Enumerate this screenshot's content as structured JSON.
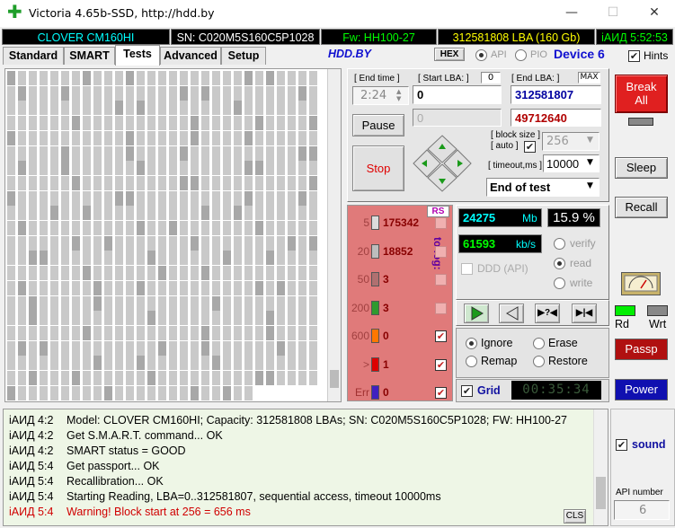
{
  "window": {
    "title": "Victoria 4.65b-SSD, http://hdd.by",
    "minimize": "—",
    "maximize": "☐",
    "close": "✕"
  },
  "infobar": {
    "model": "CLOVER CM160HI",
    "serial": "SN: C020M5S160C5P1028",
    "firmware": "Fw: HH100-27",
    "lba": "312581808 LBA (160 Gb)",
    "time": "iАИД 5:52:53"
  },
  "tabs": [
    "Standard",
    "SMART",
    "Tests",
    "Advanced",
    "Setup"
  ],
  "tab_active": "Tests",
  "toolbar": {
    "site": "HDD.BY",
    "hex": "HEX",
    "api": "API",
    "pio": "PIO",
    "device": "Device 6",
    "hints": "Hints",
    "hints_checked": true
  },
  "test": {
    "end_time_label": "[ End time ]",
    "end_time_value": "2:24",
    "start_lba_label": "[ Start LBA: ]",
    "start_lba_small": "0",
    "start_lba_value": "0",
    "start_lba_current": "0",
    "end_lba_label": "[ End LBA: ]",
    "end_lba_max": "MAX",
    "end_lba_value": "312581807",
    "end_lba_current": "49712640",
    "pause": "Pause",
    "stop": "Stop",
    "block_size_label": "[ block size ]",
    "block_auto_label": "[ auto ]",
    "block_size_value": "256",
    "timeout_label": "[ timeout,ms ]",
    "timeout_value": "10000",
    "end_action": "End of test"
  },
  "histogram": {
    "rs": "RS",
    "to_log": "to log:",
    "rows": [
      {
        "label": "5",
        "value": "175342",
        "color": "#dcdcdc",
        "log": false
      },
      {
        "label": "20",
        "value": "18852",
        "color": "#bdbdbd",
        "log": false
      },
      {
        "label": "50",
        "value": "3",
        "color": "#b07070",
        "log": false
      },
      {
        "label": "200",
        "value": "3",
        "color": "#2f9a2f",
        "log": false
      },
      {
        "label": "600",
        "value": "0",
        "color": "#ff7700",
        "log": true
      },
      {
        "label": ">",
        "value": "1",
        "color": "#dd0000",
        "log": true
      },
      {
        "label": "Err",
        "value": "0",
        "color": "#4020c0",
        "log": true
      }
    ]
  },
  "stats": {
    "mb": "24275",
    "mb_unit": "Mb",
    "percent": "15.9 %",
    "speed": "61593",
    "speed_unit": "kb/s",
    "ddd": "DDD (API)",
    "verify": "verify",
    "read": "read",
    "write": "write"
  },
  "actions": {
    "ignore": "Ignore",
    "erase": "Erase",
    "remap": "Remap",
    "restore": "Restore",
    "grid": "Grid",
    "timer": "00:35:34",
    "selected": "Ignore"
  },
  "side": {
    "break_all_1": "Break",
    "break_all_2": "All",
    "sleep": "Sleep",
    "recall": "Recall",
    "rd": "Rd",
    "wrt": "Wrt",
    "passp": "Passp",
    "power": "Power",
    "sound": "sound",
    "api_number_label": "API number",
    "api_number": "6"
  },
  "log": {
    "cls": "CLS",
    "lines": [
      {
        "time": "iАИД 4:2",
        "text": "Model: CLOVER  CM160HI; Capacity: 312581808 LBAs; SN: C020M5S160C5P1028; FW: HH100-27",
        "warn": false
      },
      {
        "time": "iАИД 4:2",
        "text": "Get S.M.A.R.T. command... OK",
        "warn": false
      },
      {
        "time": "iАИД 4:2",
        "text": "SMART status = GOOD",
        "warn": false
      },
      {
        "time": "iАИД 5:4",
        "text": "Get passport... OK",
        "warn": false
      },
      {
        "time": "iАИД 5:4",
        "text": "Recallibration... OK",
        "warn": false
      },
      {
        "time": "iАИД 5:4",
        "text": "Starting Reading, LBA=0..312581807, sequential access, timeout 10000ms",
        "warn": false
      },
      {
        "time": "iАИД 5:4",
        "text": "Warning! Block start at 256 = 656 ms",
        "warn": true
      }
    ]
  },
  "colors": {
    "accent_cyan": "#00ffff",
    "accent_green": "#00ff00",
    "accent_yellow": "#ffff00",
    "break_red": "#e02020",
    "passp_red": "#b01010",
    "power_blue": "#1010b0",
    "warn": "#d00000"
  }
}
